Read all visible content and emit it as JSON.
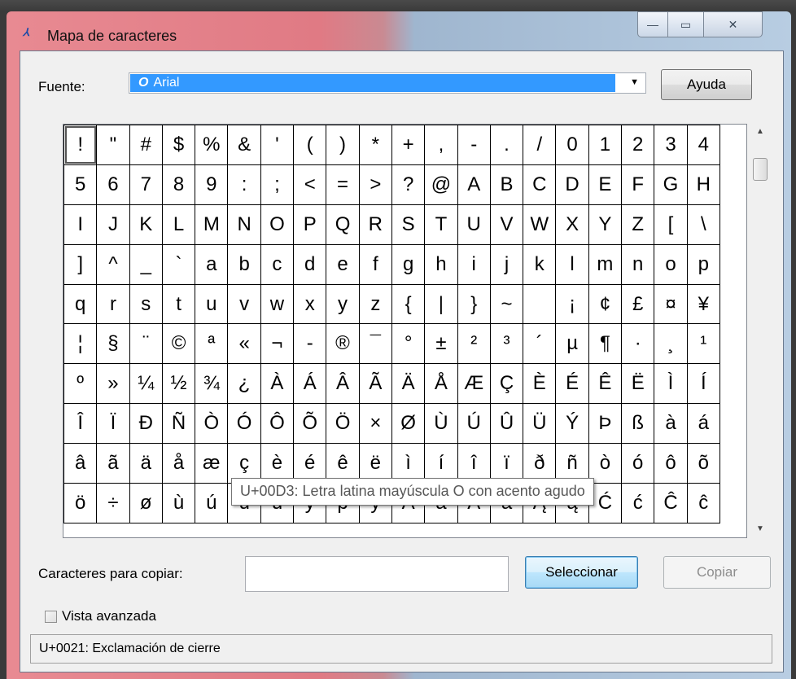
{
  "window": {
    "title": "Mapa de caracteres",
    "icon": "charmap-icon",
    "icon_glyph": "⅄"
  },
  "caption_buttons": {
    "minimize": "—",
    "maximize": "▭",
    "close": "✕"
  },
  "font": {
    "label": "Fuente:",
    "selected": "Arial",
    "font_icon_glyph": "O",
    "dropdown_arrow": "▼"
  },
  "buttons": {
    "help": "Ayuda",
    "select": "Seleccionar",
    "copy": "Copiar"
  },
  "grid": {
    "rows": [
      [
        "!",
        "\"",
        "#",
        "$",
        "%",
        "&",
        "'",
        "(",
        ")",
        "*",
        "+",
        ",",
        "-",
        ".",
        "/",
        "0",
        "1",
        "2",
        "3",
        "4"
      ],
      [
        "5",
        "6",
        "7",
        "8",
        "9",
        ":",
        ";",
        "<",
        "=",
        ">",
        "?",
        "@",
        "A",
        "B",
        "C",
        "D",
        "E",
        "F",
        "G",
        "H"
      ],
      [
        "I",
        "J",
        "K",
        "L",
        "M",
        "N",
        "O",
        "P",
        "Q",
        "R",
        "S",
        "T",
        "U",
        "V",
        "W",
        "X",
        "Y",
        "Z",
        "[",
        "\\"
      ],
      [
        "]",
        "^",
        "_",
        "`",
        "a",
        "b",
        "c",
        "d",
        "e",
        "f",
        "g",
        "h",
        "i",
        "j",
        "k",
        "l",
        "m",
        "n",
        "o",
        "p"
      ],
      [
        "q",
        "r",
        "s",
        "t",
        "u",
        "v",
        "w",
        "x",
        "y",
        "z",
        "{",
        "|",
        "}",
        "~",
        " ",
        "¡",
        "¢",
        "£",
        "¤",
        "¥"
      ],
      [
        "¦",
        "§",
        "¨",
        "©",
        "ª",
        "«",
        "¬",
        "-",
        "®",
        "¯",
        "°",
        "±",
        "²",
        "³",
        "´",
        "µ",
        "¶",
        "·",
        "¸",
        "¹"
      ],
      [
        "º",
        "»",
        "¼",
        "½",
        "¾",
        "¿",
        "À",
        "Á",
        "Â",
        "Ã",
        "Ä",
        "Å",
        "Æ",
        "Ç",
        "È",
        "É",
        "Ê",
        "Ë",
        "Ì",
        "Í"
      ],
      [
        "Î",
        "Ï",
        "Ð",
        "Ñ",
        "Ò",
        "Ó",
        "Ô",
        "Õ",
        "Ö",
        "×",
        "Ø",
        "Ù",
        "Ú",
        "Û",
        "Ü",
        "Ý",
        "Þ",
        "ß",
        "à",
        "á"
      ],
      [
        "â",
        "ã",
        "ä",
        "å",
        "æ",
        "ç",
        "è",
        "é",
        "ê",
        "ë",
        "ì",
        "í",
        "î",
        "ï",
        "ð",
        "ñ",
        "ò",
        "ó",
        "ô",
        "õ"
      ],
      [
        "ö",
        "÷",
        "ø",
        "ù",
        "ú",
        "û",
        "ü",
        "ý",
        "þ",
        "ÿ",
        "Ā",
        "ā",
        "Ă",
        "ă",
        "Ą",
        "ą",
        "Ć",
        "ć",
        "Ĉ",
        "ĉ"
      ]
    ],
    "selected_char": "!"
  },
  "scrollbar": {
    "up_arrow": "▲",
    "down_arrow": "▼"
  },
  "copy_field": {
    "label": "Caracteres para copiar:",
    "value": ""
  },
  "advanced": {
    "label": "Vista avanzada",
    "checked": false
  },
  "status": "U+0021: Exclamación de cierre",
  "tooltip": "U+00D3: Letra latina mayúscula O con acento agudo"
}
